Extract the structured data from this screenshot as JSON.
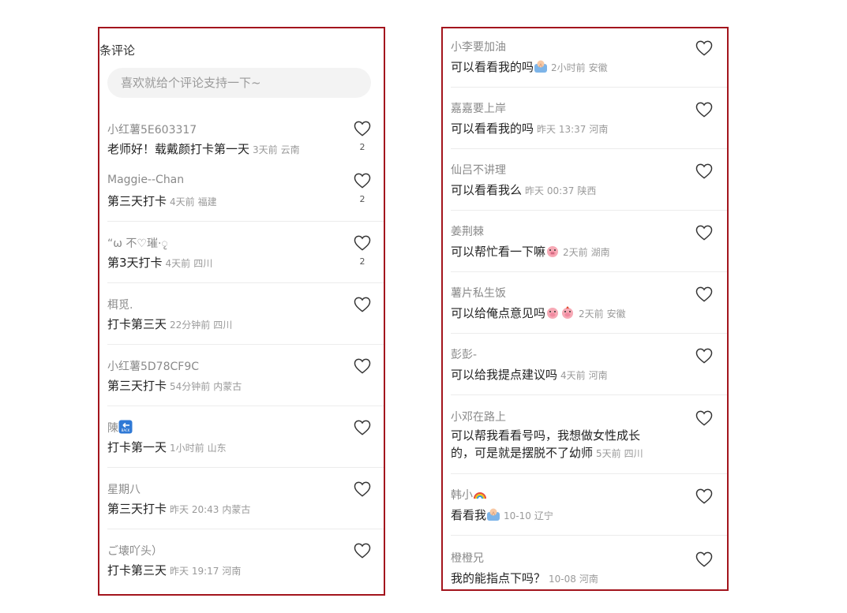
{
  "left": {
    "header": "条评论",
    "search_placeholder": "喜欢就给个评论支持一下~",
    "comments": [
      {
        "user": "小红薯5E603317",
        "text": "老师好！载戴颜打卡第一天",
        "time": "3天前",
        "location": "云南",
        "likes": "2"
      },
      {
        "user": "Maggie--Chan",
        "text": "第三天打卡",
        "time": "4天前",
        "location": "福建",
        "likes": "2"
      },
      {
        "user": "“ω 不♡璀·ृ",
        "text": "第3天打卡",
        "time": "4天前",
        "location": "四川",
        "likes": "2"
      },
      {
        "user": "栮觅.",
        "text": "打卡第三天",
        "time": "22分钟前",
        "location": "四川",
        "likes": ""
      },
      {
        "user": "小红薯5D78CF9C",
        "text": "第三天打卡",
        "time": "54分钟前",
        "location": "内蒙古",
        "likes": ""
      },
      {
        "user": "陳",
        "user_icon": "back-arrow-emoji-icon",
        "text": "打卡第一天",
        "time": "1小时前",
        "location": "山东",
        "likes": ""
      },
      {
        "user": "星期八",
        "text": "第三天打卡",
        "time": "昨天 20:43",
        "location": "内蒙古",
        "likes": ""
      },
      {
        "user": "ご壊吖头）",
        "text": "打卡第三天",
        "time": "昨天 19:17",
        "location": "河南",
        "likes": ""
      }
    ]
  },
  "right": {
    "comments": [
      {
        "user": "小李要加油",
        "text": "可以看看我的吗",
        "emoji": "praying-emoji-icon",
        "time": "2小时前",
        "location": "安徽"
      },
      {
        "user": "嘉嘉要上岸",
        "text": "可以看看我的吗",
        "time": "昨天 13:37",
        "location": "河南"
      },
      {
        "user": "仙吕不讲理",
        "text": "可以看看我么",
        "time": "昨天 00:37",
        "location": "陕西"
      },
      {
        "user": "姜荆棘",
        "text": "可以帮忙看一下嘛",
        "emoji": "pig-emoji-icon",
        "time": "2天前",
        "location": "湖南"
      },
      {
        "user": "薯片私生饭",
        "text": "可以给俺点意见吗",
        "emoji": "pig-pair-emoji-icon",
        "time": "2天前",
        "location": "安徽"
      },
      {
        "user": "彭彭-",
        "text": "可以给我提点建议吗",
        "time": "4天前",
        "location": "河南"
      },
      {
        "user": "小邓在路上",
        "text": "可以帮我看看号吗，我想做女性成长的，可是就是摆脱不了幼师",
        "time": "5天前",
        "location": "四川"
      },
      {
        "user": "韩小",
        "user_icon": "rainbow-emoji-icon",
        "text": "看看我",
        "emoji": "praying-emoji-icon",
        "time": "10-10",
        "location": "辽宁"
      },
      {
        "user": "橙橙兄",
        "text": "我的能指点下吗？",
        "time": "10-08",
        "location": "河南"
      }
    ]
  },
  "colors": {
    "panel_border": "#a3151d",
    "username": "#8a8a8a",
    "meta": "#9a9a9a",
    "search_bg": "#f3f3f3"
  }
}
